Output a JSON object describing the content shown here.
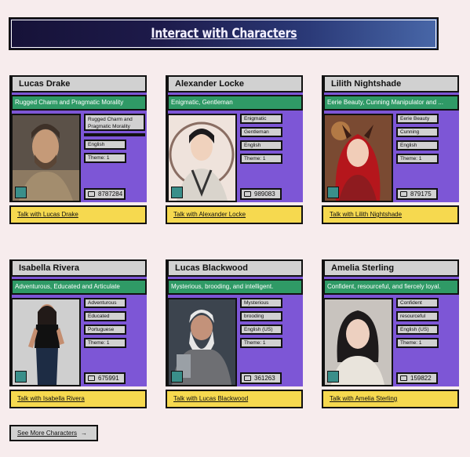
{
  "header": {
    "title": "Interact with Characters"
  },
  "cards": [
    {
      "name": "Lucas Drake",
      "description": "Rugged Charm and Pragmatic Morality",
      "tags": [
        "Rugged Charm and Pragmatic Morality",
        "",
        "English",
        "Theme: 1"
      ],
      "count": "8787284",
      "talk": "Talk with Lucas Drake"
    },
    {
      "name": "Alexander Locke",
      "description": "Enigmatic, Gentleman",
      "tags": [
        "Enigmatic",
        "Gentleman",
        "English",
        "Theme: 1"
      ],
      "count": "989083",
      "talk": "Talk with Alexander Locke"
    },
    {
      "name": "Lilith Nightshade",
      "description": "Eerie Beauty, Cunning Manipulator and ...",
      "tags": [
        "Eerie Beauty",
        "Cunning",
        "English",
        "Theme: 1"
      ],
      "count": "879175",
      "talk": "Talk with Lilith Nightshade"
    },
    {
      "name": "Isabella Rivera",
      "description": "Adventurous, Educated and Articulate",
      "tags": [
        "Adventurous",
        "Educated",
        "Portuguese",
        "Theme: 1"
      ],
      "count": "675991",
      "talk": "Talk with Isabella Rivera"
    },
    {
      "name": "Lucas Blackwood",
      "description": "Mysterious, brooding, and intelligent.",
      "tags": [
        "Mysterious",
        "brooding",
        "English (US)",
        "Theme: 1"
      ],
      "count": "361263",
      "talk": "Talk with Lucas Blackwood"
    },
    {
      "name": "Amelia Sterling",
      "description": "Confident, resourceful, and fiercely loyal.",
      "tags": [
        "Confident",
        "resourceful",
        "English (US)",
        "Theme: 1"
      ],
      "count": "159822",
      "talk": "Talk with Amelia Sterling"
    }
  ],
  "more_button": {
    "label": "See More Characters",
    "icon": "arrow-right-icon"
  }
}
